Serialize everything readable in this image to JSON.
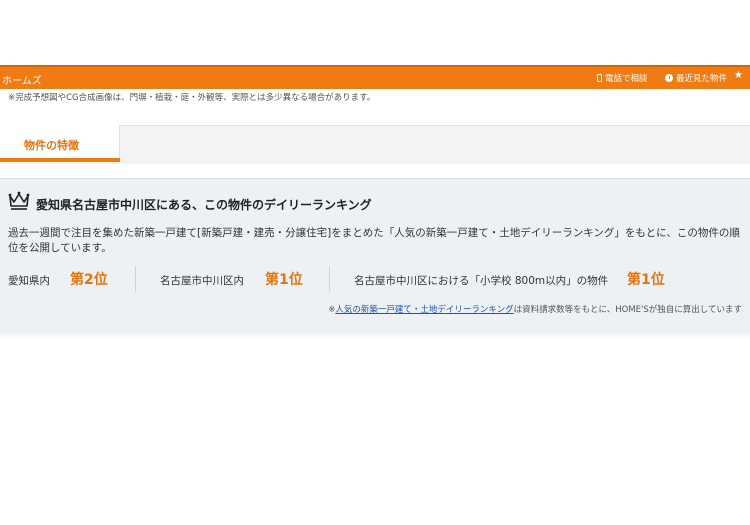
{
  "header": {
    "brand": "ホームズ",
    "items": [
      {
        "icon": "phone-icon",
        "label": "電話で相談"
      },
      {
        "icon": "clock-icon",
        "label": "最近見た物件"
      },
      {
        "icon": "star-icon",
        "label": ""
      }
    ],
    "color": "#f07b12"
  },
  "note": "※完成予想図やCG合成画像は、門塀・植栽・庭・外観等、実際とは多少異なる場合があります。",
  "tabs": [
    {
      "label": "物件の特徴",
      "active": true
    }
  ],
  "ranking": {
    "title": "愛知県名古屋市中川区にある、この物件のデイリーランキング",
    "description": "過去一週間で注目を集めた新築一戸建て[新築戸建・建売・分譲住宅]をまとめた「人気の新築一戸建て・土地デイリーランキング」をもとに、この物件の順位を公開しています。",
    "items": [
      {
        "label": "愛知県内",
        "rank": "第2位"
      },
      {
        "label": "名古屋市中川区内",
        "rank": "第1位"
      },
      {
        "label": "名古屋市中川区における「小学校 800m以内」の物件",
        "rank": "第1位"
      }
    ],
    "footnote_prefix": "※",
    "footnote_link": "人気の新築一戸建て・土地デイリーランキング",
    "footnote_suffix": "は資料請求数等をもとに、HOME'Sが独自に算出しています",
    "accent": "#e8730f"
  }
}
